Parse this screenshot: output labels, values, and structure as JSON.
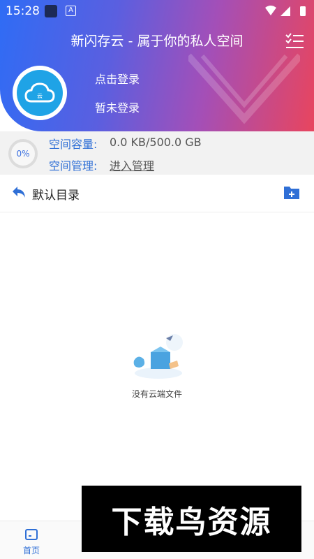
{
  "statusbar": {
    "time": "15:28"
  },
  "header": {
    "title": "新闪存云 - 属于你的私人空间",
    "login_link": "点击登录",
    "login_status": "暂未登录"
  },
  "storage": {
    "percent_label": "0%",
    "capacity_label": "空间容量:",
    "capacity_value": "0.0 KB/500.0 GB",
    "management_label": "空间管理:",
    "management_link": "进入管理"
  },
  "folder": {
    "name": "默认目录"
  },
  "empty_state": {
    "text": "没有云端文件"
  },
  "bottom_nav": {
    "items": [
      {
        "label": "首页",
        "icon": "home-icon",
        "active": true
      },
      {
        "label": "",
        "icon": "nav-icon-2",
        "active": false
      },
      {
        "label": "",
        "icon": "nav-icon-3",
        "active": false
      },
      {
        "label": "",
        "icon": "nav-icon-4",
        "active": false
      },
      {
        "label": "",
        "icon": "nav-icon-5",
        "active": false
      }
    ]
  },
  "watermark": {
    "text": "下载鸟资源"
  },
  "colors": {
    "accent": "#2f6fd6",
    "gradient_start": "#2f6cf5",
    "gradient_end": "#e8455e"
  }
}
